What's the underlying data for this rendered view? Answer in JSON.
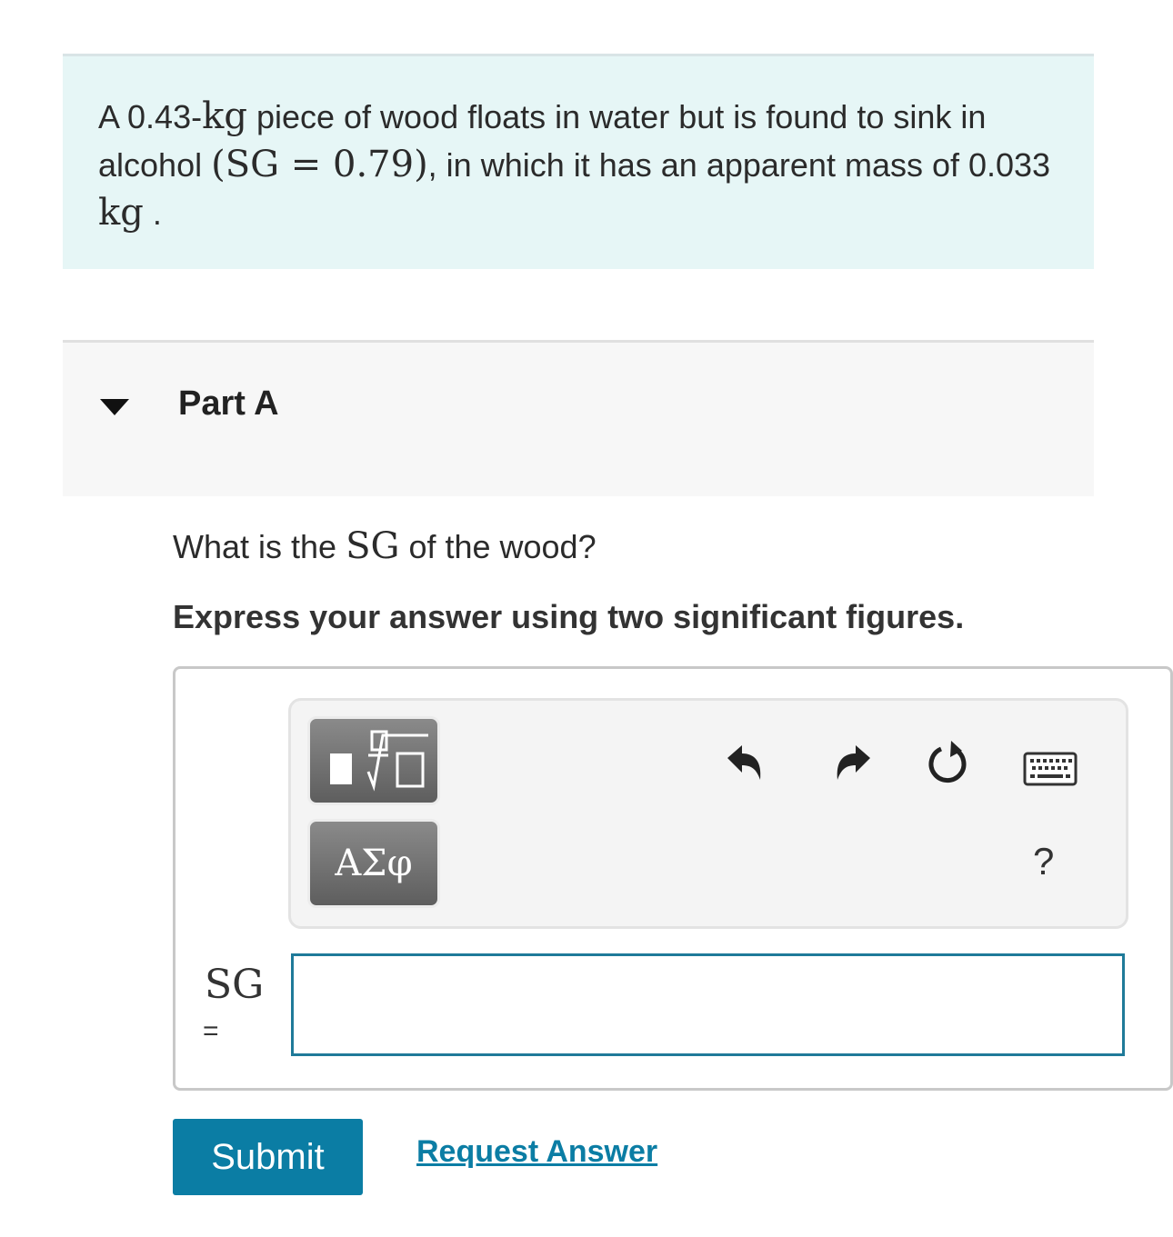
{
  "problem": {
    "p1": "A 0.43-",
    "m1": "kg",
    "p2": " piece of wood floats in water but is found to sink in alcohol ",
    "m2": "(SG = 0.79)",
    "p3": ", in which it has an apparent mass of 0.033 ",
    "m3": "kg",
    "p4": " ."
  },
  "part": {
    "title": "Part A",
    "question_pre": "What is the ",
    "question_math": "SG",
    "question_post": " of the wood?",
    "instruction": "Express your answer using two significant figures."
  },
  "toolbar": {
    "templates_icon": "fraction-root-template-icon",
    "symbols_label": "ΑΣφ",
    "undo_icon": "undo-icon",
    "redo_icon": "redo-icon",
    "reset_icon": "reset-icon",
    "keyboard_icon": "keyboard-icon",
    "help_label": "?"
  },
  "answer": {
    "variable": "SG",
    "equals": "=",
    "value": "",
    "placeholder": ""
  },
  "actions": {
    "submit_label": "Submit",
    "request_label": "Request Answer"
  },
  "colors": {
    "problem_bg": "#e6f6f6",
    "accent": "#0b7da4",
    "input_border": "#1f7a99"
  }
}
